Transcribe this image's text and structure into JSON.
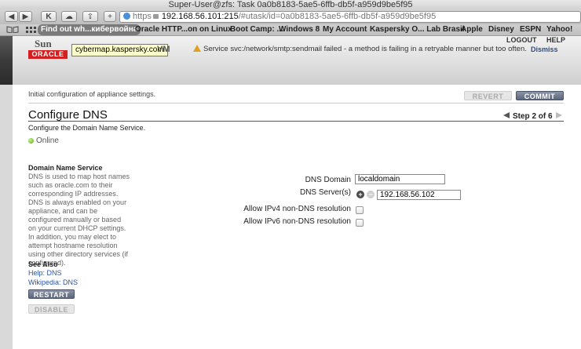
{
  "window": {
    "title": "Super-User@zfs: Task 0a0b8183-5ae5-6ffb-db5f-a959d9be5f95"
  },
  "toolbar": {
    "back": "◀",
    "forward": "▶",
    "k_logo": "K",
    "cloud": "☁",
    "share": "⇪",
    "new_tab": "+",
    "url_scheme": "https",
    "url_host": "192.168.56.101:215",
    "url_path": "/#utask/id=0a0b8183-5ae5-6ffb-db5f-a959d9be5f95"
  },
  "bookmarks": [
    {
      "label": "Find out wh...кибервойна",
      "active": true
    },
    {
      "label": "Oracle HTTP...on on Linux"
    },
    {
      "label": "Boot Camp: ..."
    },
    {
      "label": "Windows 8"
    },
    {
      "label": "My Account"
    },
    {
      "label": "Kaspersky O... Lab Brasil"
    },
    {
      "label": "Apple"
    },
    {
      "label": "Disney"
    },
    {
      "label": "ESPN"
    },
    {
      "label": "Yahoo!"
    }
  ],
  "header": {
    "logo_sun": "Sun",
    "logo_oracle": "ORACLE",
    "tooltip": "cybermap.kaspersky.com",
    "vm": "VM",
    "alert_text": "Service svc:/network/smtp:sendmail failed - a method is failing in a retryable manner but too often.",
    "dismiss": "Dismiss",
    "logout": "LOGOUT",
    "help": "HELP"
  },
  "page": {
    "instruction": "Initial configuration of appliance settings.",
    "revert": "REVERT",
    "commit": "COMMIT",
    "title": "Configure DNS",
    "step": "Step 2 of 6",
    "subtitle": "Configure the Domain Name Service.",
    "status": "Online"
  },
  "side": {
    "title": "Domain Name Service",
    "text": "DNS is used to map host names such as oracle.com to their corresponding IP addresses. DNS is always enabled on your appliance, and can be configured manually or based on your current DHCP settings. In addition, you may elect to attempt hostname resolution using other directory services (if configured).",
    "see_also": "See Also",
    "link1": "Help: DNS",
    "link2": "Wikipedia: DNS",
    "restart": "RESTART",
    "disable": "DISABLE"
  },
  "form": {
    "domain_label": "DNS Domain",
    "domain_value": "localdomain",
    "servers_label": "DNS Server(s)",
    "server_value": "192.168.56.102",
    "plus": "+",
    "minus": "−",
    "ipv4_label": "Allow IPv4 non-DNS resolution",
    "ipv6_label": "Allow IPv6 non-DNS resolution"
  }
}
